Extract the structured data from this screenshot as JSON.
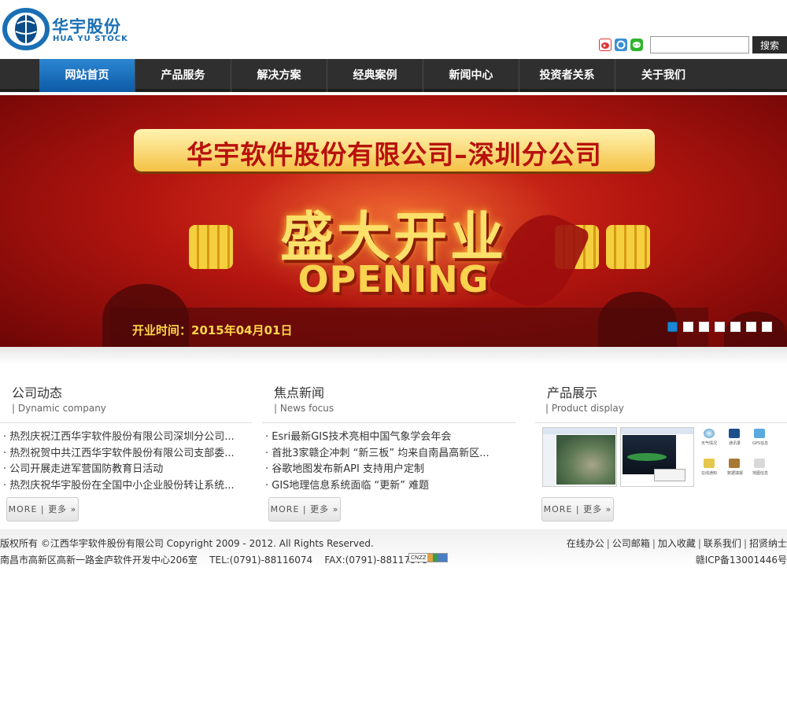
{
  "header": {
    "logo_cn": "华宇股份",
    "logo_en": "HUA YU STOCK",
    "search_button": "搜索",
    "search_value": ""
  },
  "nav": {
    "items": [
      {
        "label": "网站首页"
      },
      {
        "label": "产品服务"
      },
      {
        "label": "解决方案"
      },
      {
        "label": "经典案例"
      },
      {
        "label": "新闻中心"
      },
      {
        "label": "投资者关系"
      },
      {
        "label": "关于我们"
      }
    ],
    "active_index": 0
  },
  "banner": {
    "title": "华宇软件股份有限公司–深圳分公司",
    "headline_cn": "盛大开业",
    "headline_en": "OPENING",
    "date_text": "开业时间：2015年04月01日",
    "slide_count": 7,
    "active_slide": 1
  },
  "columns": {
    "company": {
      "title": "公司动态",
      "subtitle": "| Dynamic company",
      "items": [
        "· 热烈庆祝江西华宇软件股份有限公司深圳分公司...",
        "· 热烈祝贺中共江西华宇软件股份有限公司支部委...",
        "· 公司开展走进军营国防教育日活动",
        "· 热烈庆祝华宇股份在全国中小企业股份转让系统..."
      ],
      "more": "MORE | 更多 »"
    },
    "news": {
      "title": "焦点新闻",
      "subtitle": "| News focus",
      "items": [
        "· Esri最新GIS技术亮相中国气象学会年会",
        "· 首批3家赣企冲刺 “新三板” 均来自南昌高新区...",
        "· 谷歌地图发布新API 支持用户定制",
        "· GIS地理信息系统面临 “更新” 难题"
      ],
      "more": "MORE | 更多 »"
    },
    "products": {
      "title": "产品展示",
      "subtitle": "| Product display",
      "more": "MORE | 更多 »",
      "icon_labels": [
        "天气情况",
        "通讯录",
        "GPS信息",
        "在线通知",
        "数据填报",
        "地图信息"
      ]
    }
  },
  "footer": {
    "copyright": "版权所有 ©江西华宇软件股份有限公司 Copyright 2009 - 2012. All Rights Reserved.",
    "address": "南昌市高新区高新一路金庐软件开发中心206室    TEL:(0791)-88116074    FAX:(0791)-88117573",
    "cnzz": "CNZZ",
    "links": [
      "在线办公",
      "公司邮箱",
      "加入收藏",
      "联系我们",
      "招贤纳士"
    ],
    "icp": "赣ICP备13001446号"
  },
  "colors": {
    "brand_blue": "#1a6fb5",
    "nav_bg": "#2f2f2f",
    "nav_active": "#1a75c4",
    "banner_red": "#c0180f"
  }
}
